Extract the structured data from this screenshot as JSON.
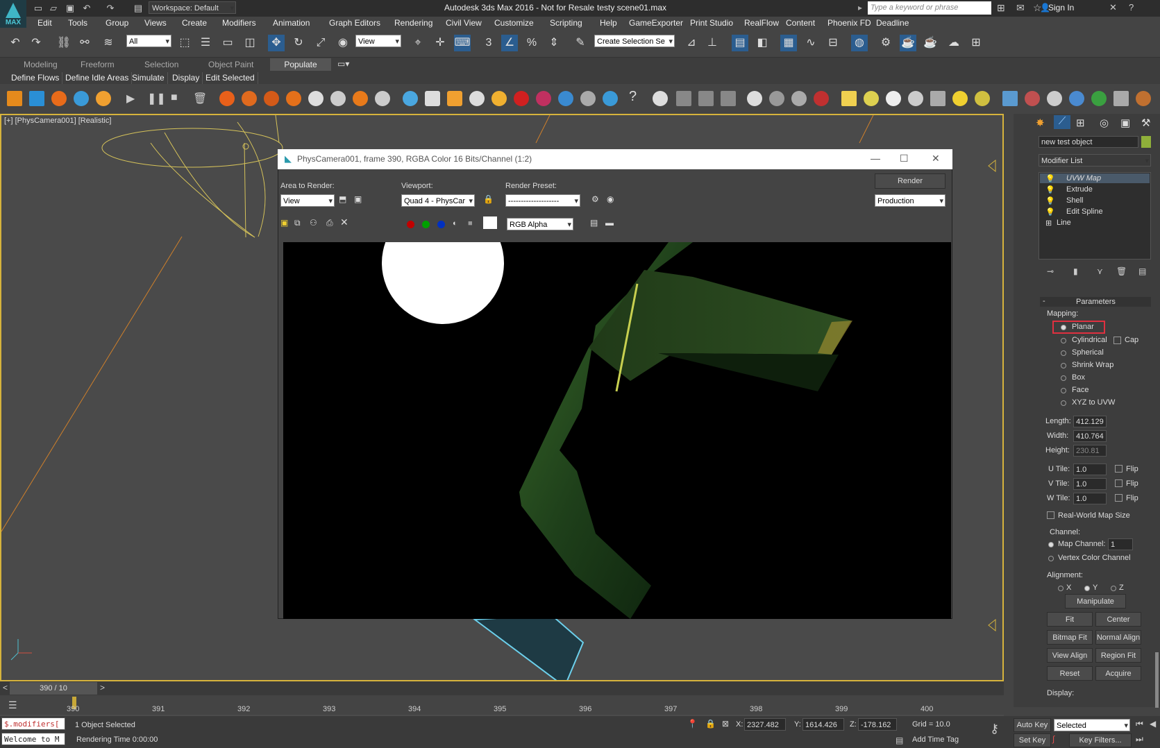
{
  "titlebar": {
    "logo": "MAX",
    "workspace": "Workspace: Default",
    "app_title": "Autodesk 3ds Max 2016 - Not for Resale",
    "file_title": "testy scene01.max",
    "search_placeholder": "Type a keyword or phrase",
    "sign_in": "Sign In"
  },
  "menus": [
    "Edit",
    "Tools",
    "Group",
    "Views",
    "Create",
    "Modifiers",
    "Animation",
    "Graph Editors",
    "Rendering",
    "Civil View",
    "Customize",
    "Scripting",
    "Help",
    "GameExporter",
    "Print Studio",
    "RealFlow",
    "Content",
    "Phoenix FD",
    "Deadline"
  ],
  "toolbar": {
    "filter_select": "All",
    "ref_coord": "View",
    "selection_set_placeholder": "Create Selection Se"
  },
  "ribbon": {
    "tabs": [
      "Modeling",
      "Freeform",
      "Selection",
      "Object Paint",
      "Populate"
    ],
    "active_tab": "Populate",
    "buttons": [
      "Define Flows",
      "Define Idle Areas",
      "Simulate",
      "Display",
      "Edit Selected"
    ]
  },
  "viewport": {
    "label": "[+] [PhysCamera001] [Realistic]"
  },
  "render_window": {
    "title": "PhysCamera001, frame 390, RGBA Color 16 Bits/Channel (1:2)",
    "area_label": "Area to Render:",
    "area_value": "View",
    "viewport_label": "Viewport:",
    "viewport_value": "Quad 4 - PhysCar",
    "preset_label": "Render Preset:",
    "preset_value": "--------------------",
    "render_button": "Render",
    "production_value": "Production",
    "channel_value": "RGB Alpha",
    "colors": {
      "red": "#c00000",
      "green": "#00a000",
      "blue": "#0030c0"
    }
  },
  "command_panel": {
    "object_name": "new test object",
    "object_color": "#8fb03a",
    "modifier_list": "Modifier List",
    "stack": [
      "UVW Map",
      "Extrude",
      "Shell",
      "Edit Spline",
      "Line"
    ],
    "parameters_header": "Parameters",
    "mapping_label": "Mapping:",
    "mapping_options": [
      "Planar",
      "Cylindrical",
      "Spherical",
      "Shrink Wrap",
      "Box",
      "Face",
      "XYZ to UVW"
    ],
    "cap_label": "Cap",
    "length_label": "Length:",
    "length_value": "412.129",
    "width_label": "Width:",
    "width_value": "410.764",
    "height_label": "Height:",
    "height_value": "230.81",
    "utile_label": "U Tile:",
    "utile_value": "1.0",
    "vtile_label": "V Tile:",
    "vtile_value": "1.0",
    "wtile_label": "W Tile:",
    "wtile_value": "1.0",
    "flip_label": "Flip",
    "real_world_label": "Real-World Map Size",
    "channel_label": "Channel:",
    "map_channel_label": "Map Channel:",
    "map_channel_value": "1",
    "vertex_color_label": "Vertex Color Channel",
    "alignment_label": "Alignment:",
    "align_x": "X",
    "align_y": "Y",
    "align_z": "Z",
    "manipulate": "Manipulate",
    "fit": "Fit",
    "center": "Center",
    "bitmap_fit": "Bitmap Fit",
    "normal_align": "Normal Align",
    "view_align": "View Align",
    "region_fit": "Region Fit",
    "reset": "Reset",
    "acquire": "Acquire",
    "display_label": "Display:"
  },
  "timeline": {
    "frame_counter": "390 / 10",
    "ticks": [
      "390",
      "391",
      "392",
      "393",
      "394",
      "395",
      "396",
      "397",
      "398",
      "399",
      "400"
    ]
  },
  "status": {
    "maxscript": "$.modifiers[",
    "welcome": "Welcome to M",
    "selected": "1 Object Selected",
    "render_time": "Rendering Time  0:00:00",
    "x_label": "X:",
    "x_value": "2327.482",
    "y_label": "Y:",
    "y_value": "1614.426",
    "z_label": "Z:",
    "z_value": "-178.162",
    "grid": "Grid = 10.0",
    "add_time_tag": "Add Time Tag",
    "auto_key": "Auto Key",
    "set_key": "Set Key",
    "key_mode": "Selected",
    "key_filters": "Key Filters..."
  }
}
